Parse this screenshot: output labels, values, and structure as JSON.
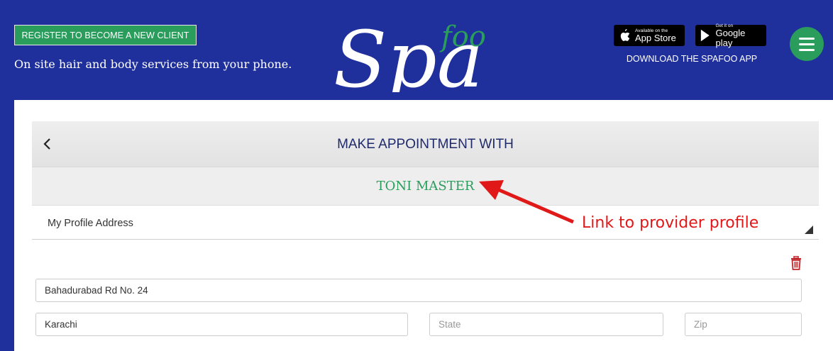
{
  "header": {
    "register_label": "REGISTER TO BECOME A NEW CLIENT",
    "tagline": "On site hair and body services from your phone.",
    "logo": {
      "text_main": "Spa",
      "text_small": "foo"
    },
    "app_store": {
      "small": "Available on the",
      "large": "App Store"
    },
    "google_play": {
      "small": "Get it on",
      "large": "Google play"
    },
    "download_text": "DOWNLOAD THE SPAFOO APP",
    "menu_icon": "hamburger-icon"
  },
  "appointment": {
    "title": "MAKE APPOINTMENT WITH",
    "provider_name": "TONI MASTER",
    "address_select_value": "My Profile Address",
    "annotation": "Link to provider profile"
  },
  "address_form": {
    "street_value": "Bahadurabad Rd No. 24",
    "city_value": "Karachi",
    "state_placeholder": "State",
    "zip_placeholder": "Zip"
  },
  "colors": {
    "background": "#1f2f9b",
    "accent_green": "#2a9d5c",
    "annotation_red": "#e01818",
    "title_navy": "#1f2a6b"
  }
}
